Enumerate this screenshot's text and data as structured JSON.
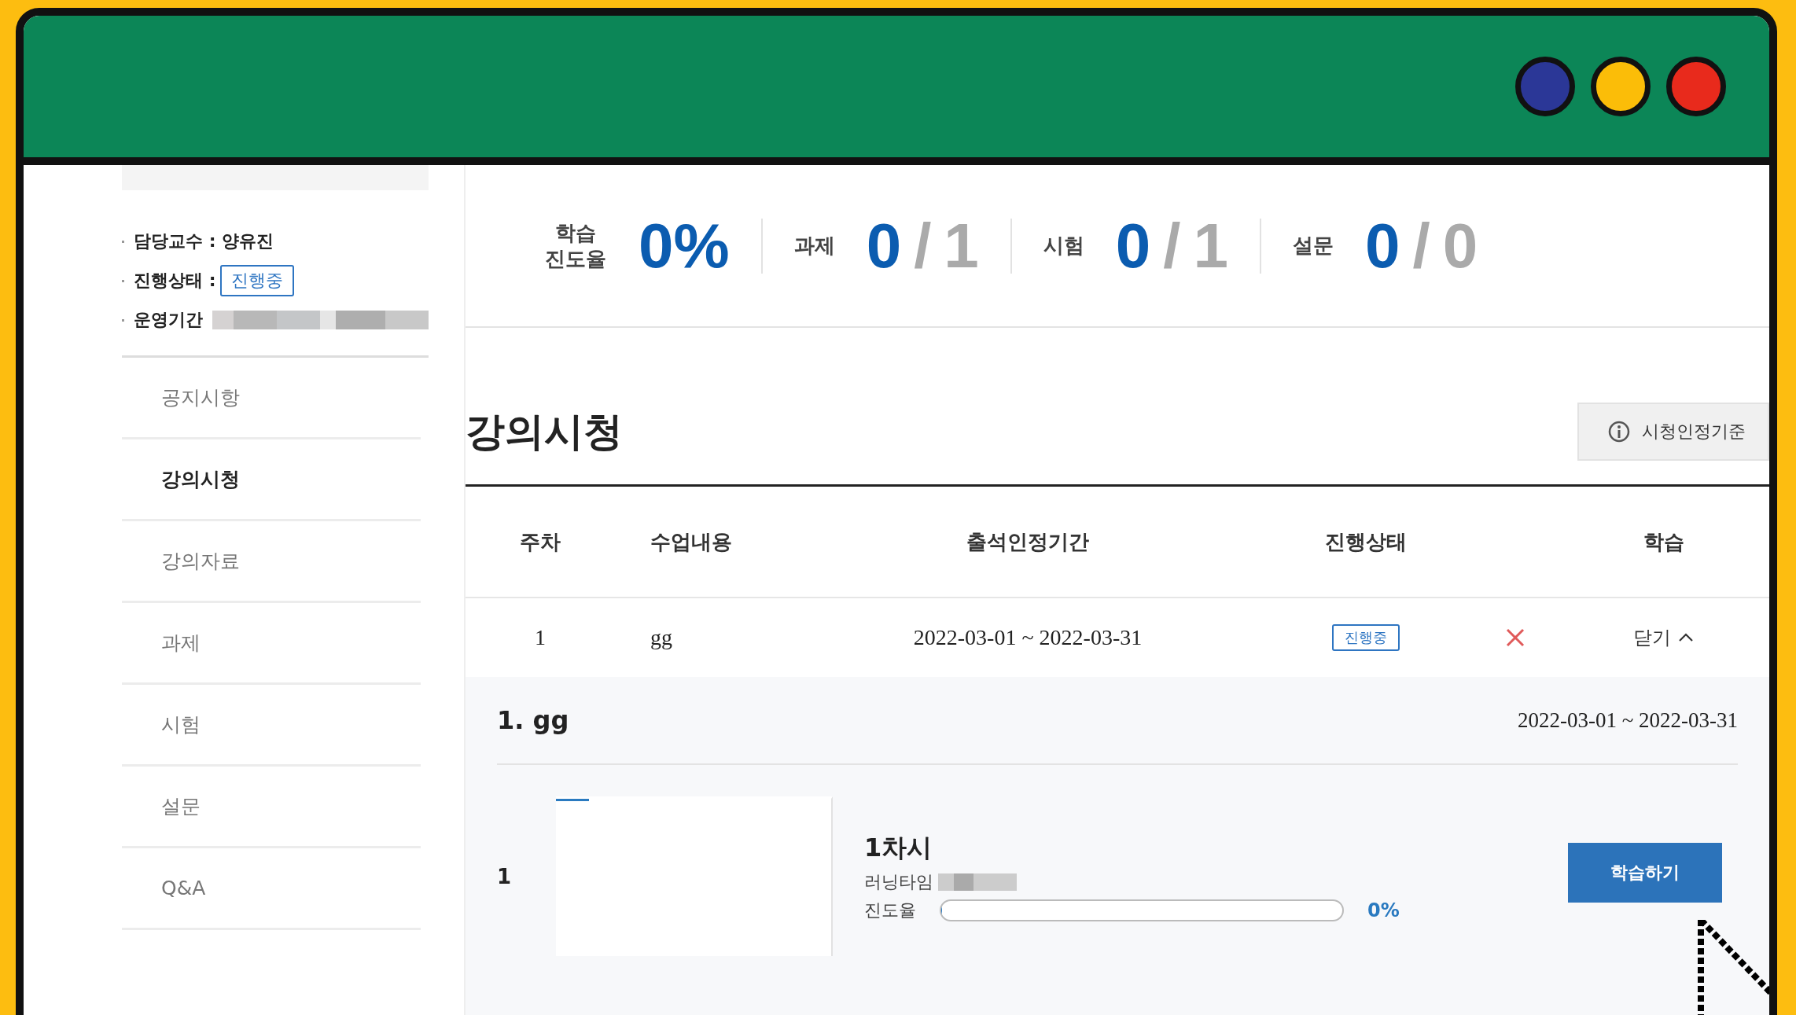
{
  "window": {
    "controls": [
      {
        "color": "#2b3797"
      },
      {
        "color": "#fbbd08"
      },
      {
        "color": "#e82a1c"
      }
    ]
  },
  "course_info": {
    "professor": "담당교수 : 양유진",
    "status_label": "진행상태 :",
    "status": "진행중",
    "period_label": "운영기간"
  },
  "sidebar": {
    "items": [
      {
        "label": "공지시항",
        "selected": false
      },
      {
        "label": "강의시청",
        "selected": true
      },
      {
        "label": "강의자료",
        "selected": false
      },
      {
        "label": "과제",
        "selected": false
      },
      {
        "label": "시험",
        "selected": false
      },
      {
        "label": "설문",
        "selected": false
      },
      {
        "label": "Q&A",
        "selected": false
      }
    ]
  },
  "stats": [
    {
      "kind": "percent",
      "label": "학습 진도율",
      "value": "0%"
    },
    {
      "kind": "ratio",
      "label": "과제",
      "done": "0",
      "separator": "/",
      "total": "1"
    },
    {
      "kind": "ratio",
      "label": "시험",
      "done": "0",
      "separator": "/",
      "total": "1"
    },
    {
      "kind": "ratio",
      "label": "설문",
      "done": "0",
      "separator": "/",
      "total": "0"
    }
  ],
  "section": {
    "title": "강의시청",
    "criteria_button": "시청인정기준"
  },
  "table": {
    "columns": [
      "주차",
      "수업내용",
      "출석인정기간",
      "진행상태",
      "학습"
    ],
    "rows": [
      {
        "week": "1",
        "content": "gg",
        "period": "2022-03-01 ~ 2022-03-31",
        "status": "진행중",
        "attended": false,
        "toggle": "닫기",
        "expanded": true,
        "detail": {
          "title": "1. gg",
          "period": "2022-03-01 ~ 2022-03-31",
          "lessons": [
            {
              "number": "1",
              "title": "1차시",
              "runtime_label": "러닝타임",
              "progress_label": "진도율",
              "level": 0,
              "progress_text": "0%",
              "button": "학습하기"
            }
          ]
        }
      }
    ]
  }
}
